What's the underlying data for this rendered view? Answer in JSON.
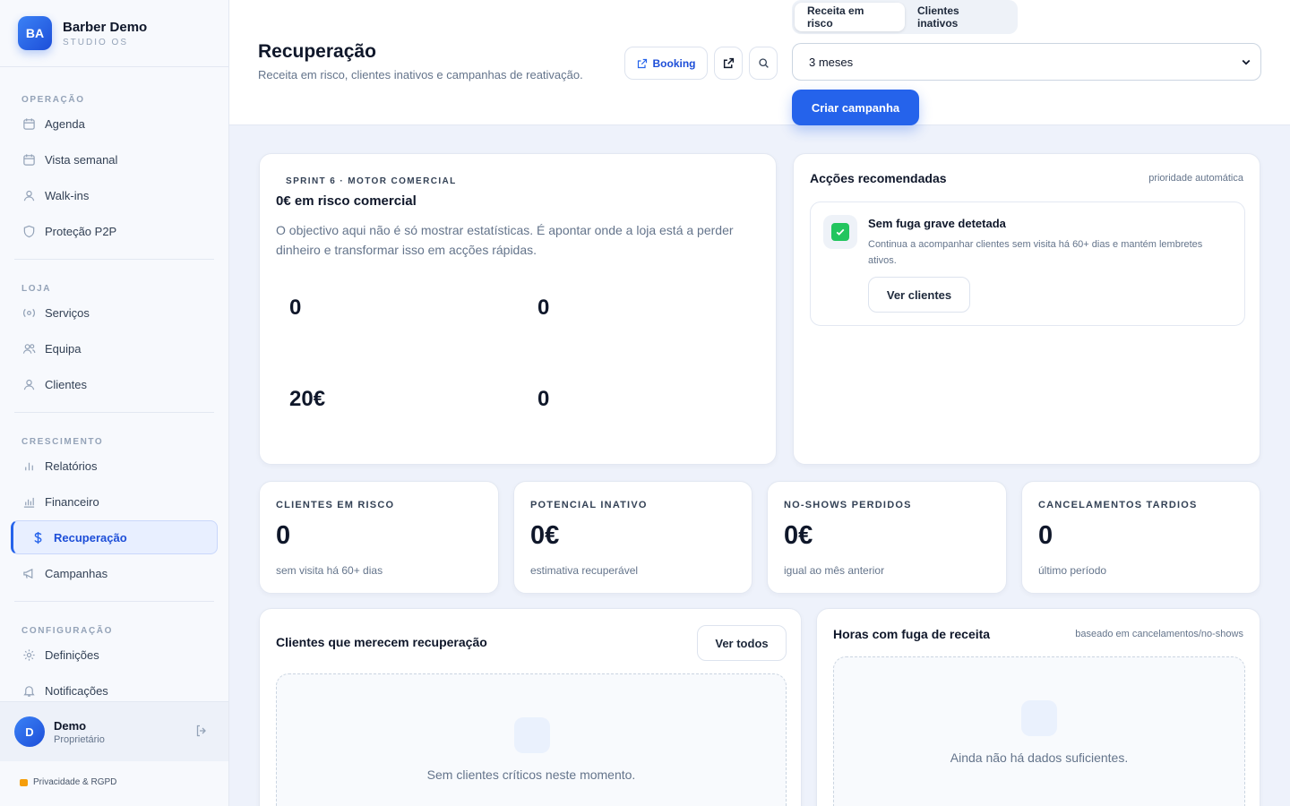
{
  "brand": {
    "initials": "BA",
    "name": "Barber Demo",
    "subtitle": "STUDIO OS"
  },
  "sidebar": {
    "sections": [
      {
        "heading": "OPERAÇÃO",
        "items": [
          "Agenda",
          "Vista semanal",
          "Walk-ins",
          "Proteção P2P"
        ]
      },
      {
        "heading": "LOJA",
        "items": [
          "Serviços",
          "Equipa",
          "Clientes"
        ]
      },
      {
        "heading": "CRESCIMENTO",
        "items": [
          "Relatórios",
          "Financeiro",
          "Recuperação",
          "Campanhas"
        ]
      },
      {
        "heading": "CONFIGURAÇÃO",
        "items": [
          "Definições",
          "Notificações"
        ]
      }
    ],
    "active_item": "Recuperação"
  },
  "user": {
    "initial": "D",
    "name": "Demo",
    "role": "Proprietário"
  },
  "privacy_link": "Privacidade & RGPD",
  "header": {
    "title": "Recuperação",
    "subtitle": "Receita em risco, clientes inativos e campanhas de reativação.",
    "booking_label": "Booking",
    "tabs": [
      "Receita em risco",
      "Clientes inativos"
    ],
    "active_tab": "Receita em risco",
    "period_select": "3 meses",
    "create_campaign_label": "Criar campanha"
  },
  "hero": {
    "eyebrow": "SPRINT 6 · MOTOR COMERCIAL",
    "title": "0€ em risco comercial",
    "description": "O objectivo aqui não é só mostrar estatísticas. É apontar onde a loja está a perder dinheiro e transformar isso em acções rápidas.",
    "metrics": [
      "0",
      "0",
      "20€",
      "0"
    ]
  },
  "recommended": {
    "title": "Acções recomendadas",
    "tag": "prioridade automática",
    "item_title": "Sem fuga grave detetada",
    "item_desc": "Continua a acompanhar clientes sem visita há 60+ dias e mantém lembretes ativos.",
    "item_button": "Ver clientes"
  },
  "stats": [
    {
      "label": "CLIENTES EM RISCO",
      "value": "0",
      "sub": "sem visita há 60+ dias"
    },
    {
      "label": "POTENCIAL INATIVO",
      "value": "0€",
      "sub": "estimativa recuperável"
    },
    {
      "label": "NO-SHOWS PERDIDOS",
      "value": "0€",
      "sub": "igual ao mês anterior"
    },
    {
      "label": "CANCELAMENTOS TARDIOS",
      "value": "0",
      "sub": "último período"
    }
  ],
  "recovery_clients": {
    "title": "Clientes que merecem recuperação",
    "button": "Ver todos",
    "empty": "Sem clientes críticos neste momento."
  },
  "revenue_hours": {
    "title": "Horas com fuga de receita",
    "tag": "baseado em cancelamentos/no-shows",
    "empty": "Ainda não há dados suficientes."
  },
  "colors": {
    "primary": "#2563eb",
    "success": "#22c55e",
    "background": "#eef2fb"
  }
}
